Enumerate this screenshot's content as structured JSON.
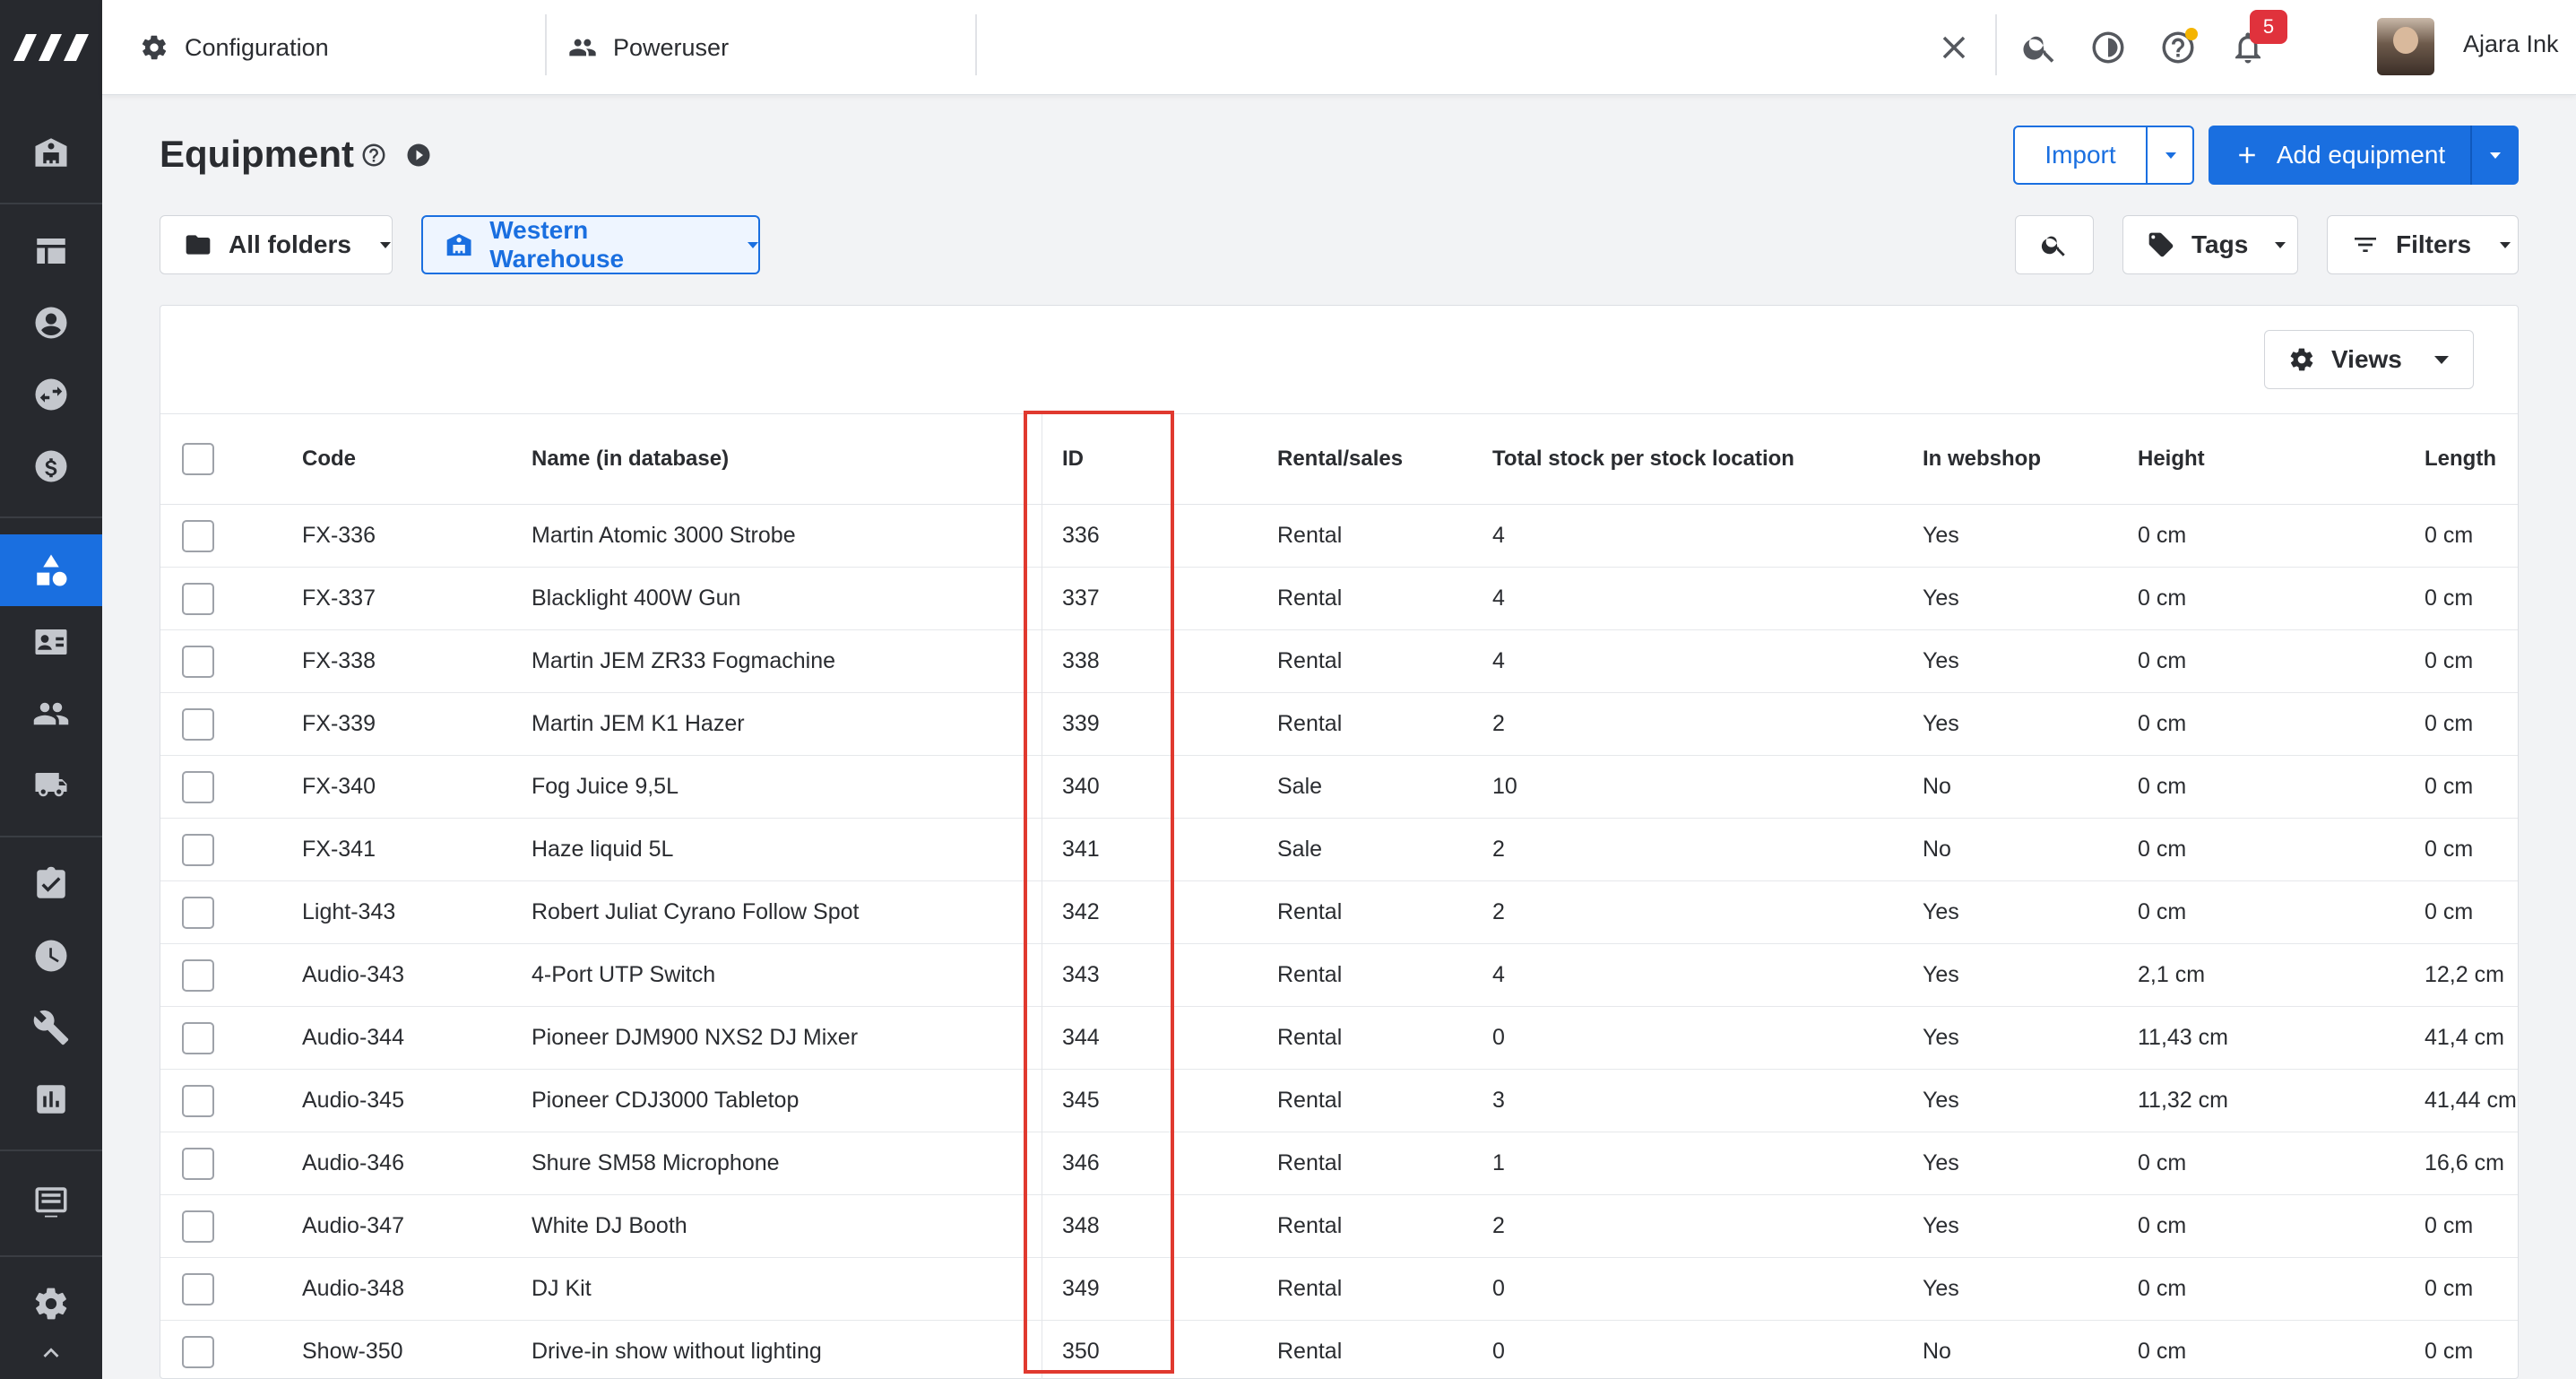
{
  "topbar": {
    "configuration": "Configuration",
    "poweruser": "Poweruser",
    "notifications_count": "5",
    "user_name": "Ajara Ink"
  },
  "page": {
    "title": "Equipment",
    "import_label": "Import",
    "add_label": "Add equipment",
    "folder_filter": "All folders",
    "warehouse_filter": "Western Warehouse",
    "tags_label": "Tags",
    "filters_label": "Filters",
    "views_label": "Views"
  },
  "table": {
    "columns": [
      "Code",
      "Name (in database)",
      "ID",
      "Rental/sales",
      "Total stock per stock location",
      "In webshop",
      "Height",
      "Length"
    ],
    "rows": [
      {
        "code": "FX-336",
        "name": "Martin Atomic 3000 Strobe",
        "id": "336",
        "type": "Rental",
        "stock": "4",
        "webshop": "Yes",
        "height": "0 cm",
        "length": "0 cm"
      },
      {
        "code": "FX-337",
        "name": "Blacklight 400W Gun",
        "id": "337",
        "type": "Rental",
        "stock": "4",
        "webshop": "Yes",
        "height": "0 cm",
        "length": "0 cm"
      },
      {
        "code": "FX-338",
        "name": "Martin JEM ZR33 Fogmachine",
        "id": "338",
        "type": "Rental",
        "stock": "4",
        "webshop": "Yes",
        "height": "0 cm",
        "length": "0 cm"
      },
      {
        "code": "FX-339",
        "name": "Martin JEM K1 Hazer",
        "id": "339",
        "type": "Rental",
        "stock": "2",
        "webshop": "Yes",
        "height": "0 cm",
        "length": "0 cm"
      },
      {
        "code": "FX-340",
        "name": "Fog Juice 9,5L",
        "id": "340",
        "type": "Sale",
        "stock": "10",
        "webshop": "No",
        "height": "0 cm",
        "length": "0 cm"
      },
      {
        "code": "FX-341",
        "name": "Haze liquid 5L",
        "id": "341",
        "type": "Sale",
        "stock": "2",
        "webshop": "No",
        "height": "0 cm",
        "length": "0 cm"
      },
      {
        "code": "Light-343",
        "name": "Robert Juliat Cyrano Follow Spot",
        "id": "342",
        "type": "Rental",
        "stock": "2",
        "webshop": "Yes",
        "height": "0 cm",
        "length": "0 cm"
      },
      {
        "code": "Audio-343",
        "name": "4-Port UTP Switch",
        "id": "343",
        "type": "Rental",
        "stock": "4",
        "webshop": "Yes",
        "height": "2,1 cm",
        "length": "12,2 cm"
      },
      {
        "code": "Audio-344",
        "name": "Pioneer DJM900 NXS2 DJ Mixer",
        "id": "344",
        "type": "Rental",
        "stock": "0",
        "webshop": "Yes",
        "height": "11,43 cm",
        "length": "41,4 cm"
      },
      {
        "code": "Audio-345",
        "name": "Pioneer CDJ3000 Tabletop",
        "id": "345",
        "type": "Rental",
        "stock": "3",
        "webshop": "Yes",
        "height": "11,32 cm",
        "length": "41,44 cm"
      },
      {
        "code": "Audio-346",
        "name": "Shure SM58 Microphone",
        "id": "346",
        "type": "Rental",
        "stock": "1",
        "webshop": "Yes",
        "height": "0 cm",
        "length": "16,6 cm"
      },
      {
        "code": "Audio-347",
        "name": "White DJ Booth",
        "id": "348",
        "type": "Rental",
        "stock": "2",
        "webshop": "Yes",
        "height": "0 cm",
        "length": "0 cm"
      },
      {
        "code": "Audio-348",
        "name": "DJ Kit",
        "id": "349",
        "type": "Rental",
        "stock": "0",
        "webshop": "Yes",
        "height": "0 cm",
        "length": "0 cm"
      },
      {
        "code": "Show-350",
        "name": "Drive-in show without lighting",
        "id": "350",
        "type": "Rental",
        "stock": "0",
        "webshop": "No",
        "height": "0 cm",
        "length": "0 cm"
      }
    ]
  },
  "colors": {
    "accent": "#1a6fe0",
    "sidebar": "#27292e",
    "highlight": "#e0392f",
    "badge": "#e0323c"
  }
}
